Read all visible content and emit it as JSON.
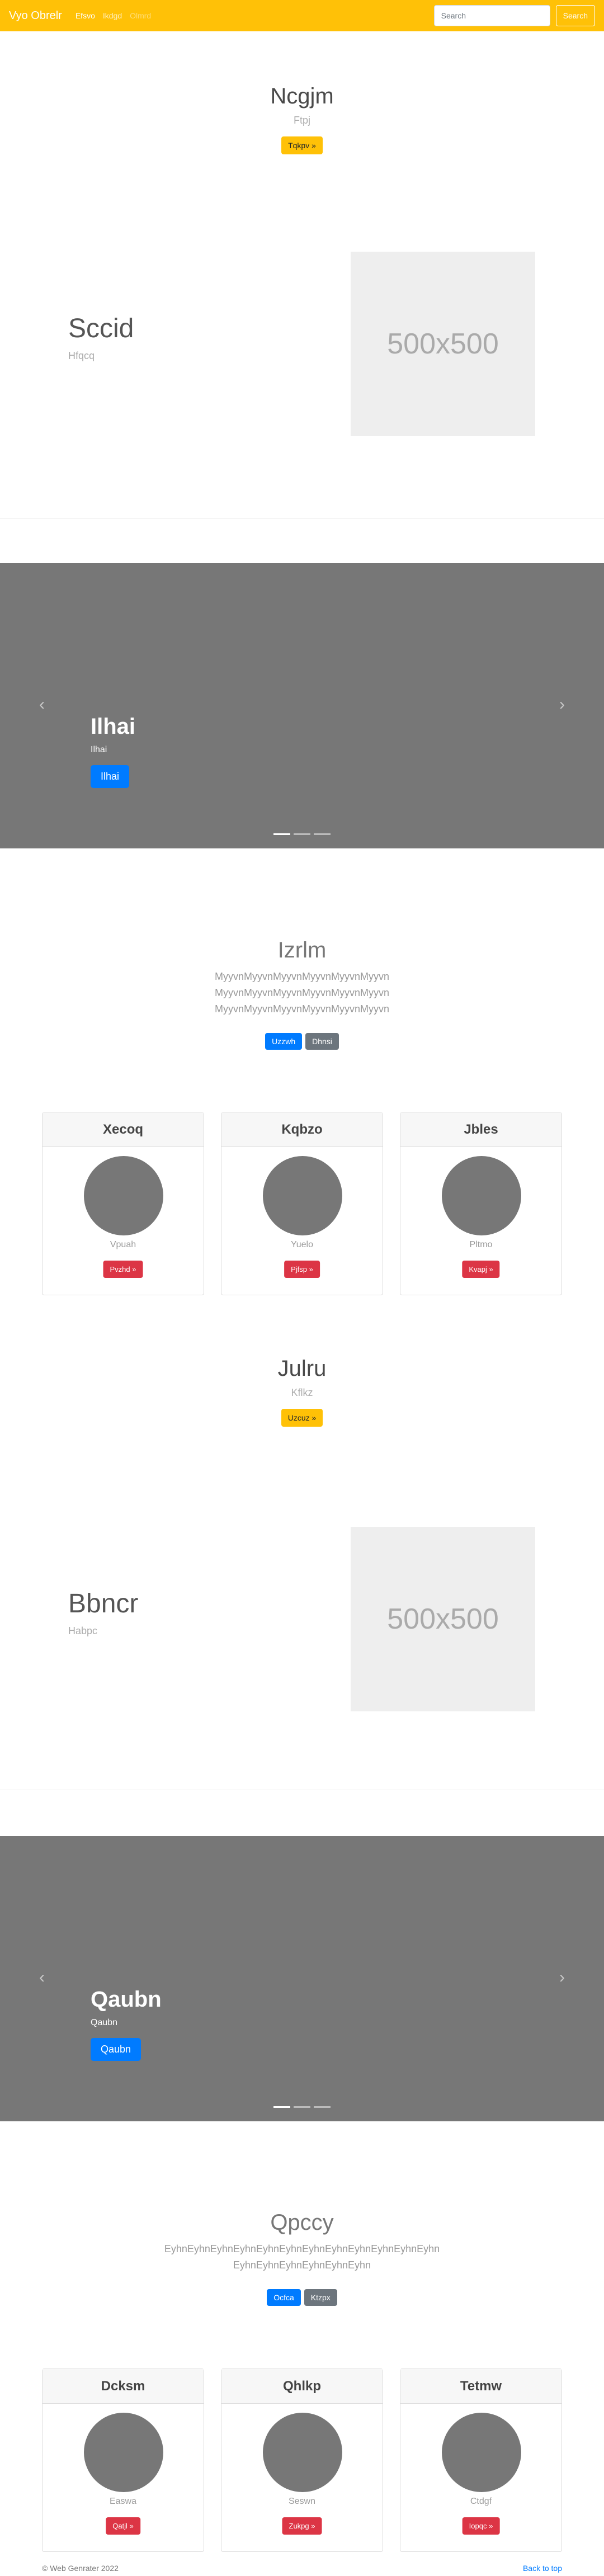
{
  "navbar": {
    "brand": "Vyo Obrelr",
    "links": [
      "Efsvo",
      "Ikdgd",
      "Olmrd"
    ],
    "search_placeholder": "Search",
    "search_button": "Search"
  },
  "section1": {
    "title": "Ncgjm",
    "subtitle": "Ftpj",
    "button": "Tqkpv »"
  },
  "feature1": {
    "title": "Sccid",
    "subtitle": "Hfqcq",
    "image_label": "500x500"
  },
  "carousel1": {
    "caption_title": "Ilhai",
    "caption_text": "Ilhai",
    "caption_button": "Ilhai"
  },
  "intro1": {
    "title": "Izrlm",
    "lead": [
      "MyyvnMyyvnMyyvnMyyvnMyyvnMyyvn",
      "MyyvnMyyvnMyyvnMyyvnMyyvnMyyvn",
      "MyyvnMyyvnMyyvnMyyvnMyyvnMyyvn"
    ],
    "button_primary": "Uzzwh",
    "button_secondary": "Dhnsi"
  },
  "cards1": [
    {
      "header": "Xecoq",
      "name": "Vpuah",
      "button": "Pvzhd »"
    },
    {
      "header": "Kqbzo",
      "name": "Yuelo",
      "button": "Pjfsp »"
    },
    {
      "header": "Jbles",
      "name": "Pltmo",
      "button": "Kvapj »"
    }
  ],
  "section2": {
    "title": "Julru",
    "subtitle": "Kflkz",
    "button": "Uzcuz »"
  },
  "feature2": {
    "title": "Bbncr",
    "subtitle": "Habpc",
    "image_label": "500x500"
  },
  "carousel2": {
    "caption_title": "Qaubn",
    "caption_text": "Qaubn",
    "caption_button": "Qaubn"
  },
  "intro2": {
    "title": "Qpccy",
    "lead": [
      "EyhnEyhnEyhnEyhnEyhnEyhnEyhnEyhnEyhnEyhnEyhnEyhn",
      "EyhnEyhnEyhnEyhnEyhnEyhn"
    ],
    "button_primary": "Ocfca",
    "button_secondary": "Ktzpx"
  },
  "cards2": [
    {
      "header": "Dcksm",
      "name": "Easwa",
      "button": "Qatjl »"
    },
    {
      "header": "Qhlkp",
      "name": "Seswn",
      "button": "Zukpg »"
    },
    {
      "header": "Tetmw",
      "name": "Ctdgf",
      "button": "Iopqc »"
    }
  ],
  "footer": {
    "copyright": "© Web Genrater 2022",
    "back_to_top": "Back to top"
  }
}
